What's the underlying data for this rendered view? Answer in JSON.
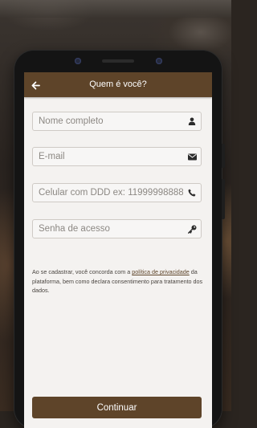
{
  "header": {
    "title": "Quem é você?",
    "back_icon": "arrow-left-icon"
  },
  "form": {
    "name": {
      "placeholder": "Nome completo",
      "value": "",
      "icon": "user-icon"
    },
    "email": {
      "placeholder": "E-mail",
      "value": "",
      "icon": "envelope-icon"
    },
    "phone": {
      "placeholder": "Celular com DDD ex: 11999998888",
      "value": "",
      "icon": "phone-icon"
    },
    "password": {
      "placeholder": "Senha de acesso",
      "value": "",
      "icon": "key-icon"
    }
  },
  "terms": {
    "prefix": "Ao se cadastrar, você concorda com a ",
    "link": "política de privacidade",
    "suffix": " da plataforma, bem como declara consentimento para tratamento dos dados."
  },
  "actions": {
    "continue_label": "Continuar"
  },
  "colors": {
    "brand": "#5e4429",
    "screen_bg": "#f4f2f0",
    "field_border": "#cfcac5"
  }
}
